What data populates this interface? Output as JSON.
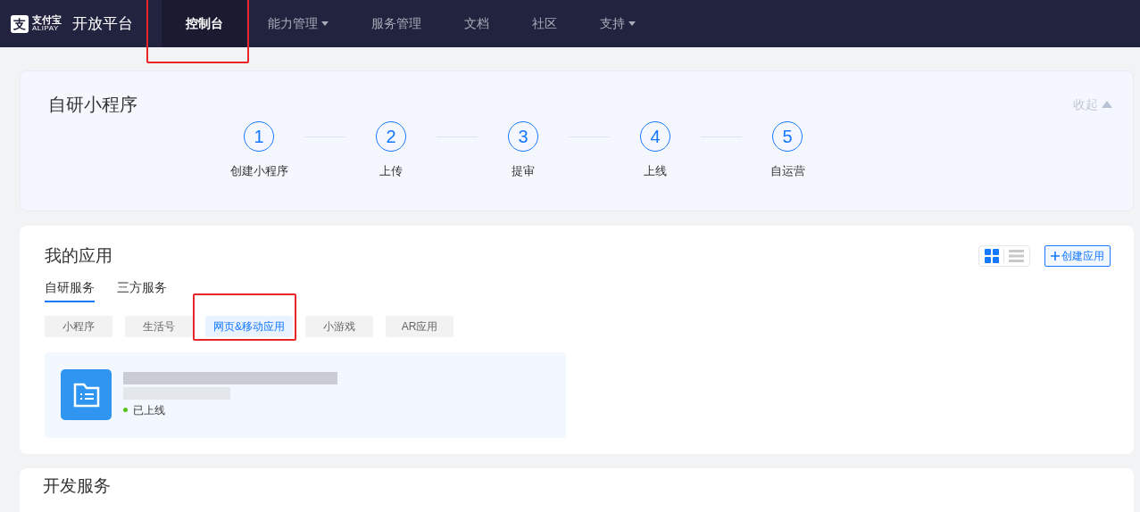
{
  "logo": {
    "mark": "支",
    "name": "支付宝",
    "subtitle": "ALIPAY",
    "platform": "开放平台"
  },
  "nav": [
    {
      "label": "控制台",
      "selected": true,
      "dropdown": false,
      "highlighted": true
    },
    {
      "label": "能力管理",
      "selected": false,
      "dropdown": true,
      "highlighted": false
    },
    {
      "label": "服务管理",
      "selected": false,
      "dropdown": false,
      "highlighted": false
    },
    {
      "label": "文档",
      "selected": false,
      "dropdown": false,
      "highlighted": false
    },
    {
      "label": "社区",
      "selected": false,
      "dropdown": false,
      "highlighted": false
    },
    {
      "label": "支持",
      "selected": false,
      "dropdown": true,
      "highlighted": false
    }
  ],
  "guide": {
    "title": "自研小程序",
    "collapse": "收起",
    "steps": [
      {
        "number": "1",
        "label": "创建小程序"
      },
      {
        "number": "2",
        "label": "上传"
      },
      {
        "number": "3",
        "label": "提审"
      },
      {
        "number": "4",
        "label": "上线"
      },
      {
        "number": "5",
        "label": "自运营"
      }
    ]
  },
  "apps": {
    "title": "我的应用",
    "view_modes": [
      {
        "kind": "grid",
        "selected": true
      },
      {
        "kind": "list",
        "selected": false
      }
    ],
    "create_button": "创建应用",
    "tabs": [
      {
        "label": "自研服务",
        "selected": true
      },
      {
        "label": "三方服务",
        "selected": false
      }
    ],
    "categories": [
      {
        "label": "小程序",
        "selected": false,
        "highlighted": false
      },
      {
        "label": "生活号",
        "selected": false,
        "highlighted": false
      },
      {
        "label": "网页&移动应用",
        "selected": true,
        "highlighted": true
      },
      {
        "label": "小游戏",
        "selected": false,
        "highlighted": false
      },
      {
        "label": "AR应用",
        "selected": false,
        "highlighted": false
      }
    ],
    "items": [
      {
        "status": "已上线",
        "color": "#52c41a"
      }
    ]
  },
  "dev_services": {
    "title": "开发服务"
  }
}
